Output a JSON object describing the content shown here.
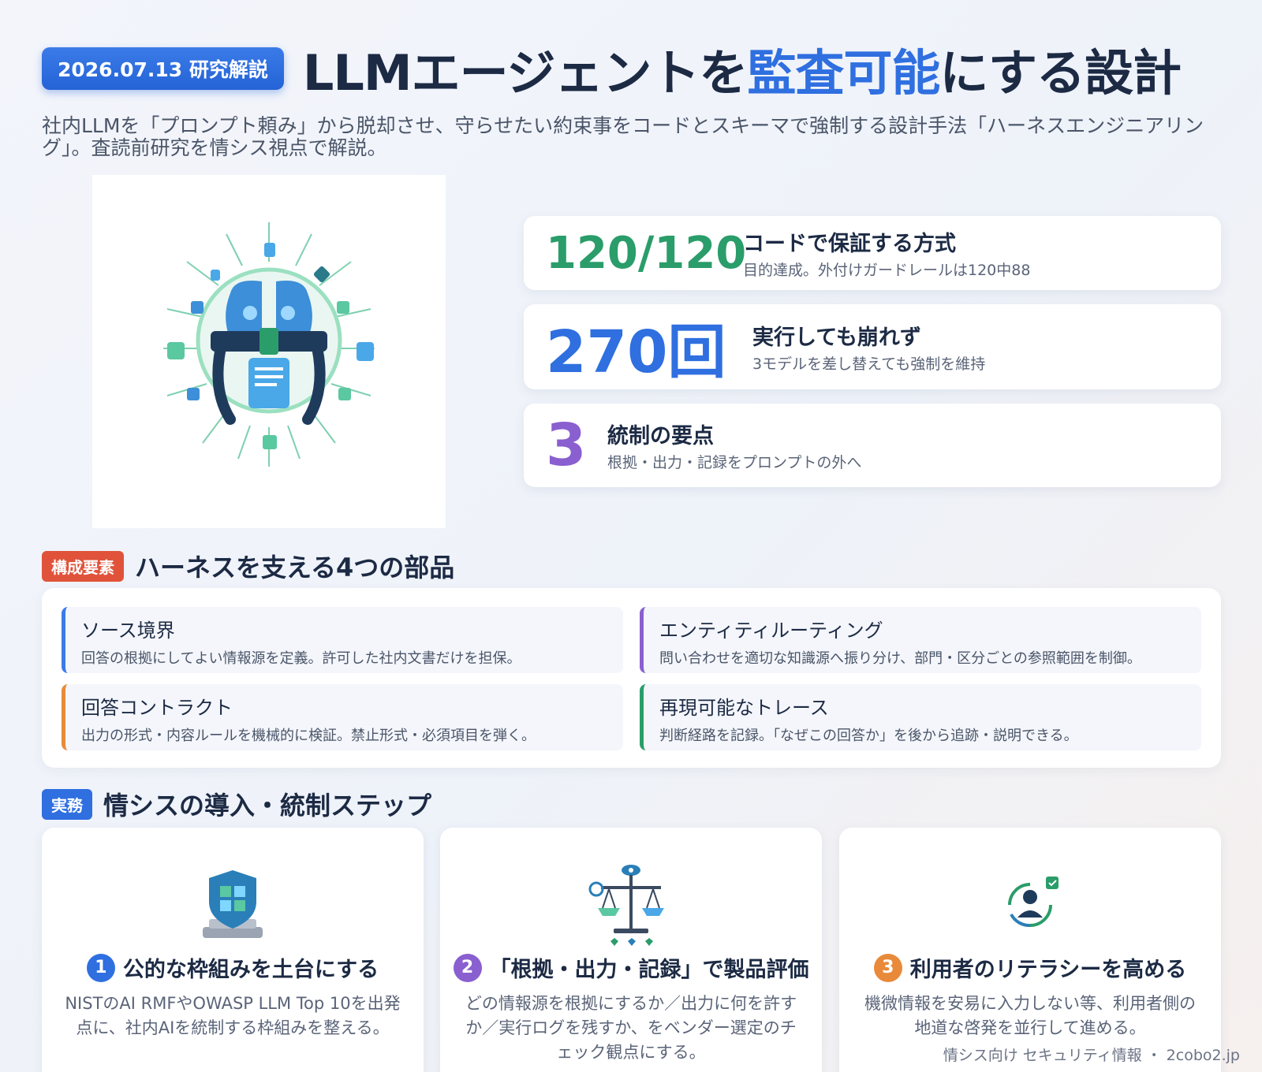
{
  "header": {
    "date_badge": "2026.07.13 研究解説",
    "title_part1": "LLMエージェントを",
    "title_highlight": "監査可能",
    "title_part2": "にする設計",
    "subtitle": "社内LLMを「プロンプト頼み」から脱却させ、守らせたい約束事をコードとスキーマで強制する設計手法「ハーネスエンジニアリング」。査読前研究を情シス視点で解説。"
  },
  "hero": {
    "icon": "ai-brain-harness-illustration"
  },
  "stats": [
    {
      "number": "120/120",
      "label": "コードで保証する方式",
      "desc": "目的達成。外付けガードレールは120中88",
      "color": "#2a9d6a"
    },
    {
      "number": "270回",
      "label": "実行しても崩れず",
      "desc": "3モデルを差し替えても強制を維持",
      "color": "#2f6fe0"
    },
    {
      "number": "3",
      "label": "統制の要点",
      "desc": "根拠・出力・記録をプロンプトの外へ",
      "color": "#8a5fd0"
    }
  ],
  "components": {
    "tag": "構成要素",
    "title": "ハーネスを支える4つの部品",
    "tag_color": "#e0533a",
    "items": [
      {
        "title": "ソース境界",
        "desc": "回答の根拠にしてよい情報源を定義。許可した社内文書だけを担保。",
        "color": "#3a7be8"
      },
      {
        "title": "エンティティルーティング",
        "desc": "問い合わせを適切な知識源へ振り分け、部門・区分ごとの参照範囲を制御。",
        "color": "#8a5fd0"
      },
      {
        "title": "回答コントラクト",
        "desc": "出力の形式・内容ルールを機械的に検証。禁止形式・必須項目を弾く。",
        "color": "#e88a3a"
      },
      {
        "title": "再現可能なトレース",
        "desc": "判断経路を記録。「なぜこの回答か」を後から追跡・説明できる。",
        "color": "#2a9d6a"
      }
    ]
  },
  "practice": {
    "tag": "実務",
    "title": "情シスの導入・統制ステップ",
    "tag_color": "#2f6fe0",
    "steps": [
      {
        "num": "1",
        "title": "公的な枠組みを土台にする",
        "desc": "NISTのAI RMFやOWASP LLM Top 10を出発点に、社内AIを統制する枠組みを整える。",
        "color": "#2f6fe0",
        "icon": "shield-blocks-icon"
      },
      {
        "num": "2",
        "title": "「根拠・出力・記録」で製品評価",
        "desc": "どの情報源を根拠にするか／出力に何を許すか／実行ログを残すか、をベンダー選定のチェック観点にする。",
        "color": "#8a5fd0",
        "icon": "balance-scale-icon"
      },
      {
        "num": "3",
        "title": "利用者のリテラシーを高める",
        "desc": "機微情報を安易に入力しない等、利用者側の地道な啓発を並行して進める。",
        "color": "#e88a3a",
        "icon": "user-cycle-icon"
      }
    ]
  },
  "footer": {
    "text": "情シス向け セキュリティ情報 ・ 2cobo2.jp"
  }
}
